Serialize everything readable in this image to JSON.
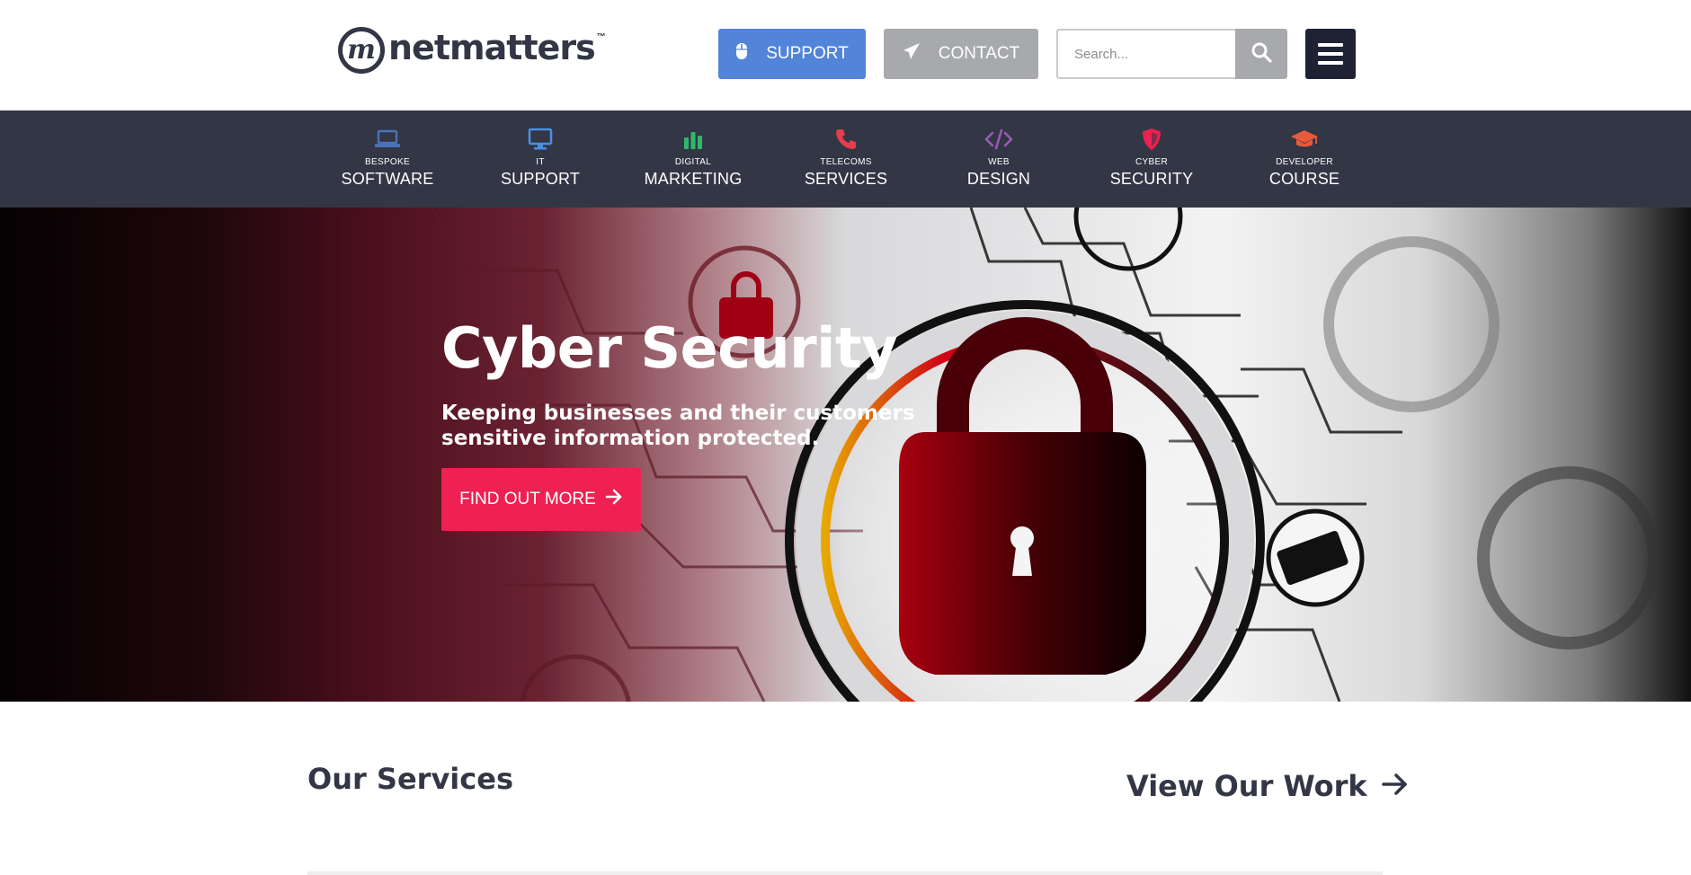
{
  "brand": {
    "name": "netmatters",
    "tm": "™",
    "mark": "m"
  },
  "header": {
    "support_label": "SUPPORT",
    "contact_label": "CONTACT",
    "search_placeholder": "Search..."
  },
  "nav": {
    "items": [
      {
        "small": "BESPOKE",
        "big": "SOFTWARE",
        "icon": "laptop-icon",
        "color": "#4a72b8"
      },
      {
        "small": "IT",
        "big": "SUPPORT",
        "icon": "monitor-icon",
        "color": "#4a8fe0"
      },
      {
        "small": "DIGITAL",
        "big": "MARKETING",
        "icon": "bar-chart-icon",
        "color": "#2fb86b"
      },
      {
        "small": "TELECOMS",
        "big": "SERVICES",
        "icon": "phone-icon",
        "color": "#e63c4b"
      },
      {
        "small": "WEB",
        "big": "DESIGN",
        "icon": "code-icon",
        "color": "#9b59b6"
      },
      {
        "small": "CYBER",
        "big": "SECURITY",
        "icon": "shield-icon",
        "color": "#ee2152"
      },
      {
        "small": "DEVELOPER",
        "big": "COURSE",
        "icon": "graduation-cap-icon",
        "color": "#e85a3c"
      }
    ]
  },
  "hero": {
    "title": "Cyber Security",
    "subtitle": "Keeping businesses and their customers sensitive information protected.",
    "cta_label": "FIND OUT MORE"
  },
  "main": {
    "services_title": "Our Services",
    "view_work_label": "View Our Work"
  },
  "colors": {
    "navy": "#333645",
    "support_blue": "#5284d7",
    "contact_grey": "#a7a9ac",
    "cta_pink": "#ee2152"
  }
}
